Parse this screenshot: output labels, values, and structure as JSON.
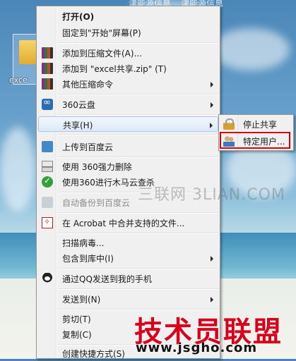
{
  "desktop": {
    "top_text_1": "津能源信息",
    "top_text_2": "津能源信息",
    "folder_label": "exce"
  },
  "context_menu": {
    "items": [
      {
        "label": "打开(O)",
        "icon": "none",
        "bold": true
      },
      {
        "label": "固定到\"开始\"屏幕(P)",
        "icon": "none"
      },
      {
        "label": "添加到压缩文件(A)...",
        "icon": "winrar-books-icon"
      },
      {
        "label": "添加到 \"excel共享.zip\" (T)",
        "icon": "winrar-books-icon"
      },
      {
        "label": "其他压缩命令",
        "icon": "winrar-books-icon",
        "submenu": true
      },
      {
        "label": "360云盘",
        "icon": "360-cloud-icon",
        "submenu": true
      },
      {
        "label": "共享(H)",
        "icon": "none",
        "submenu": true,
        "highlighted": true
      },
      {
        "label": "上传到百度云",
        "icon": "baidu-cloud-icon"
      },
      {
        "label": "使用 360强力删除",
        "icon": "shredder-icon"
      },
      {
        "label": "使用360进行木马云查杀",
        "icon": "trojan-scan-icon"
      },
      {
        "label": "自动备份到百度云",
        "icon": "baidu-backup-icon",
        "disabled": true
      },
      {
        "label": "在 Acrobat 中合并支持的文件...",
        "icon": "acrobat-icon"
      },
      {
        "label": "扫描病毒...",
        "icon": "none"
      },
      {
        "label": "包含到库中(I)",
        "icon": "none",
        "submenu": true
      },
      {
        "label": "通过QQ发送到我的手机",
        "icon": "qq-penguin-icon"
      },
      {
        "label": "发送到(N)",
        "icon": "none",
        "submenu": true
      },
      {
        "label": "剪切(T)",
        "icon": "none"
      },
      {
        "label": "复制(C)",
        "icon": "none"
      },
      {
        "label": "创建快捷方式(S)",
        "icon": "none"
      }
    ]
  },
  "share_submenu": {
    "items": [
      {
        "label": "停止共享",
        "icon": "lock-icon"
      },
      {
        "label": "特定用户...",
        "icon": "users-icon",
        "outlined": true
      }
    ]
  },
  "watermarks": {
    "site_cn": "三联网 3LIAN.COM",
    "site_title": "技术员联盟",
    "site_url": "www.jsgho.com"
  },
  "colors": {
    "highlight_border": "#a8c8eb",
    "red_outline": "#dd0000",
    "watermark_red": "#d8001b"
  }
}
